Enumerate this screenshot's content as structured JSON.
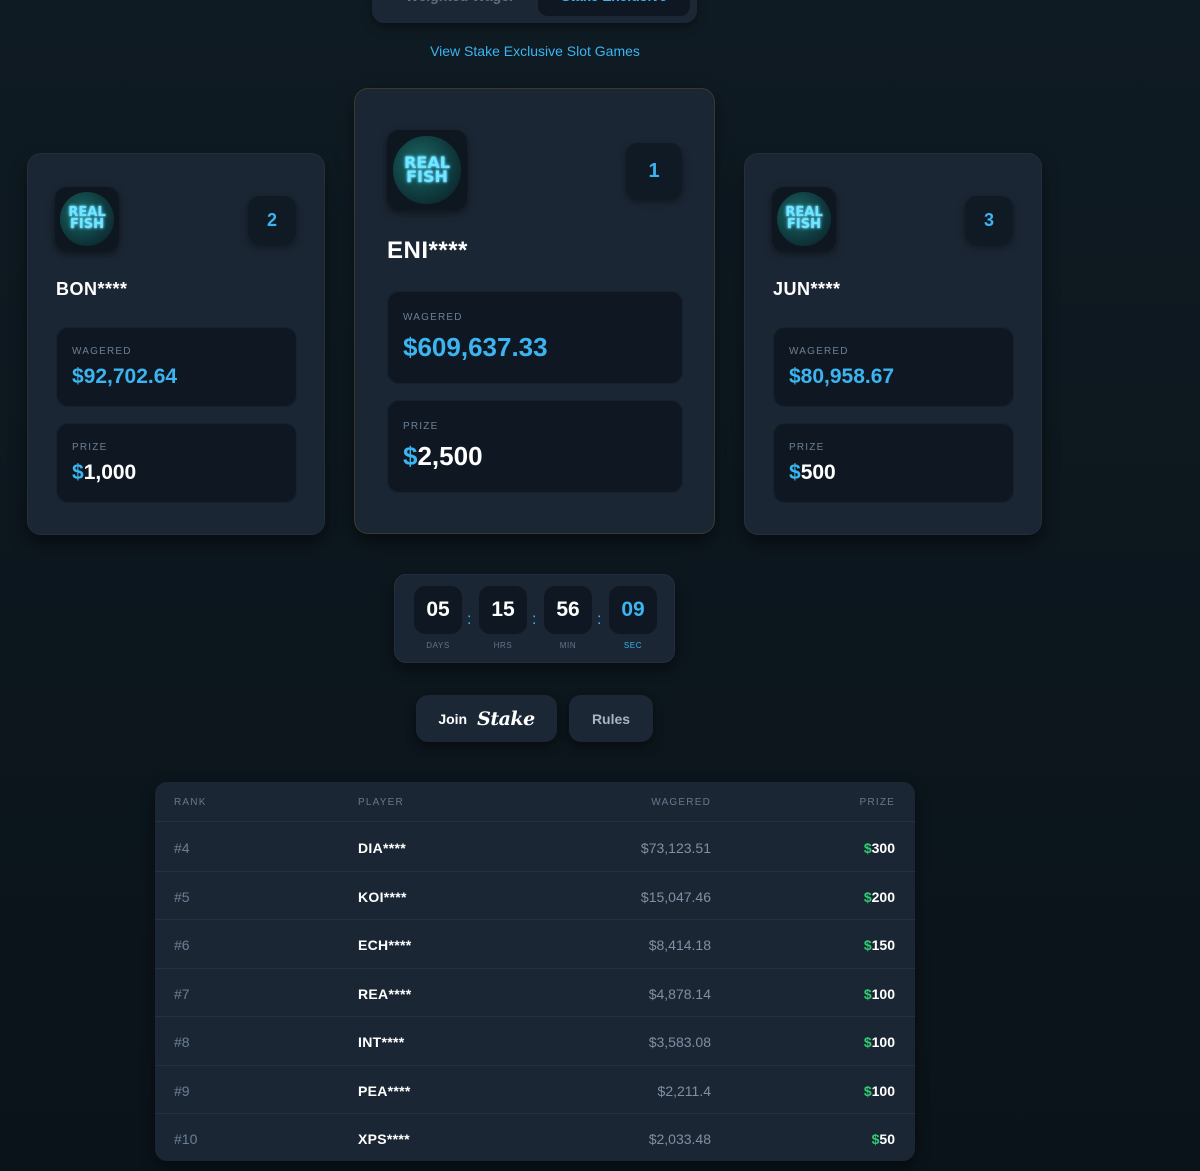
{
  "tabs": {
    "weighted_label": "Weighted Wager",
    "exclusive_label": "Stake Exclusive"
  },
  "view_link": "View Stake Exclusive Slot Games",
  "logo_text": {
    "line1": "REAL",
    "line2": "FISH"
  },
  "podium": {
    "first": {
      "rank": "1",
      "player": "ENI****",
      "wagered_label": "WAGERED",
      "wagered": "$609,637.33",
      "prize_label": "PRIZE",
      "prize_currency": "$",
      "prize_amount": "2,500"
    },
    "second": {
      "rank": "2",
      "player": "BON****",
      "wagered_label": "WAGERED",
      "wagered": "$92,702.64",
      "prize_label": "PRIZE",
      "prize_currency": "$",
      "prize_amount": "1,000"
    },
    "third": {
      "rank": "3",
      "player": "JUN****",
      "wagered_label": "WAGERED",
      "wagered": "$80,958.67",
      "prize_label": "PRIZE",
      "prize_currency": "$",
      "prize_amount": "500"
    }
  },
  "countdown": {
    "days": "05",
    "hrs": "15",
    "min": "56",
    "sec": "09",
    "days_label": "DAYS",
    "hrs_label": "HRS",
    "min_label": "MIN",
    "sec_label": "SEC",
    "separator": ":"
  },
  "buttons": {
    "join": "Join",
    "join_brand": "Stake",
    "rules": "Rules"
  },
  "table": {
    "headers": {
      "rank": "RANK",
      "player": "PLAYER",
      "wagered": "WAGERED",
      "prize": "PRIZE"
    },
    "rows": [
      {
        "rank": "#4",
        "player": "DIA****",
        "wagered": "$73,123.51",
        "prize_currency": "$",
        "prize_amount": "300"
      },
      {
        "rank": "#5",
        "player": "KOI****",
        "wagered": "$15,047.46",
        "prize_currency": "$",
        "prize_amount": "200"
      },
      {
        "rank": "#6",
        "player": "ECH****",
        "wagered": "$8,414.18",
        "prize_currency": "$",
        "prize_amount": "150"
      },
      {
        "rank": "#7",
        "player": "REA****",
        "wagered": "$4,878.14",
        "prize_currency": "$",
        "prize_amount": "100"
      },
      {
        "rank": "#8",
        "player": "INT****",
        "wagered": "$3,583.08",
        "prize_currency": "$",
        "prize_amount": "100"
      },
      {
        "rank": "#9",
        "player": "PEA****",
        "wagered": "$2,211.4",
        "prize_currency": "$",
        "prize_amount": "100"
      },
      {
        "rank": "#10",
        "player": "XPS****",
        "wagered": "$2,033.48",
        "prize_currency": "$",
        "prize_amount": "50"
      }
    ]
  },
  "colors": {
    "accent": "#3bb4f0",
    "prize_dollar": "#2ecc71",
    "background": "#0c161d",
    "card": "#1b2634"
  }
}
